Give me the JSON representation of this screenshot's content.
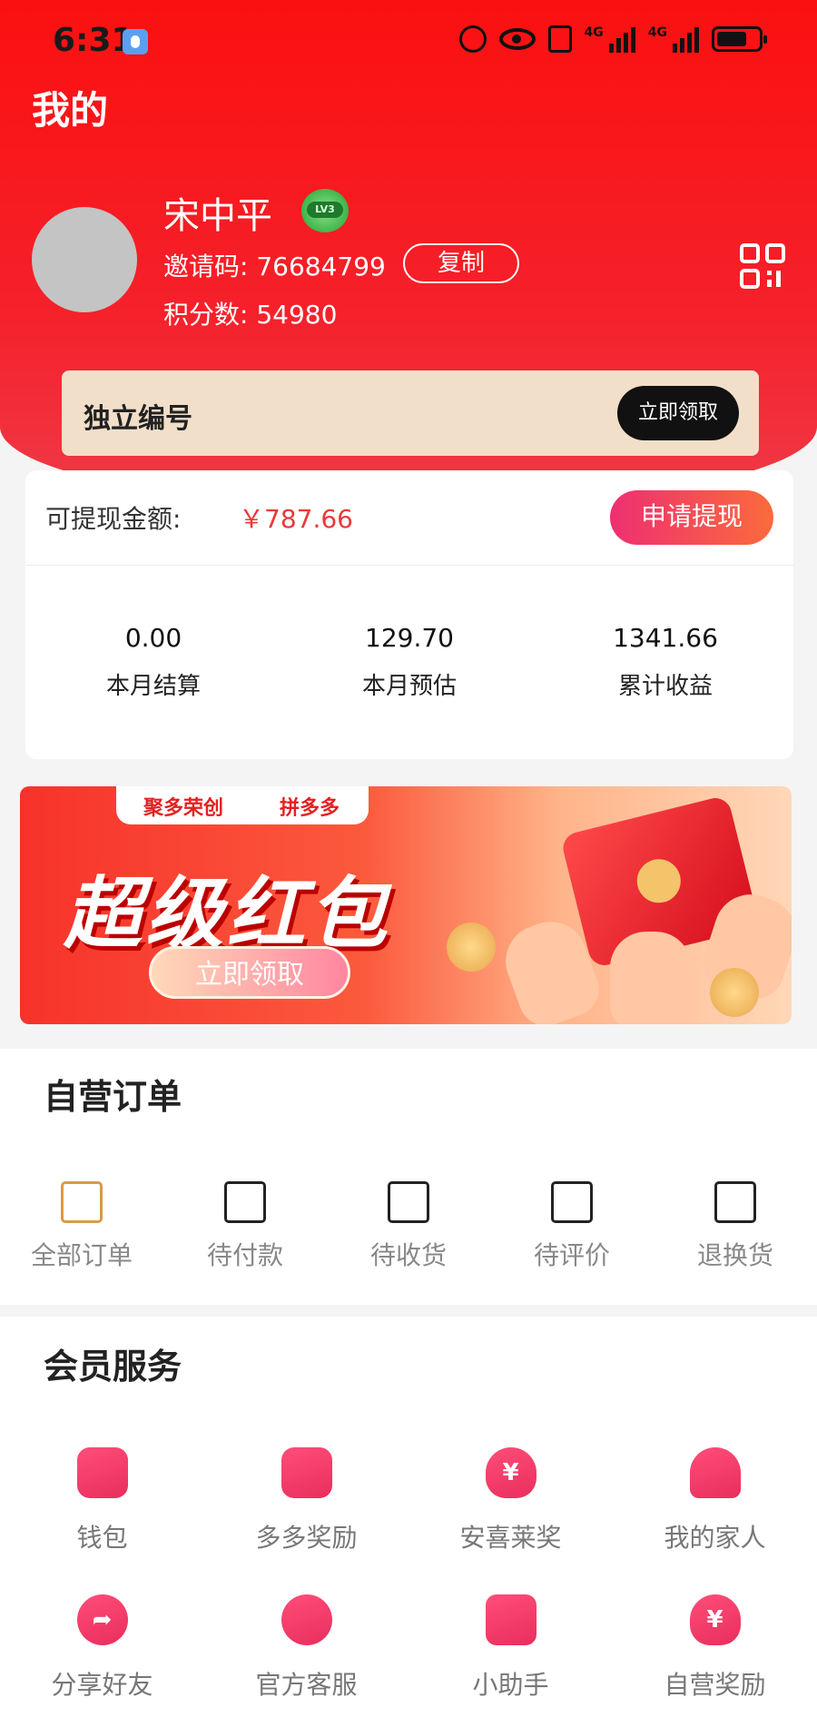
{
  "status_bar": {
    "time": "6:31",
    "network": "4G"
  },
  "header": {
    "title": "我的",
    "user_name": "宋中平",
    "level_badge": "LV3",
    "invite_label": "邀请码: 76684799",
    "copy_label": "复制",
    "points_label": "积分数: 54980"
  },
  "id_card": {
    "label": "独立编号",
    "button": "立即领取"
  },
  "earnings": {
    "withdraw_label": "可提现金额:",
    "withdraw_amount": "￥787.66",
    "withdraw_button": "申请提现",
    "stats": [
      {
        "value": "0.00",
        "label": "本月结算"
      },
      {
        "value": "129.70",
        "label": "本月预估"
      },
      {
        "value": "1341.66",
        "label": "累计收益"
      }
    ]
  },
  "banner": {
    "brand1": "聚多荣创",
    "brand2": "拼多多",
    "title": "超级红包",
    "button": "立即领取"
  },
  "orders": {
    "title": "自营订单",
    "items": [
      {
        "label": "全部订单",
        "icon": "clipboard-icon"
      },
      {
        "label": "待付款",
        "icon": "wallet-icon"
      },
      {
        "label": "待收货",
        "icon": "truck-icon"
      },
      {
        "label": "待评价",
        "icon": "review-icon"
      },
      {
        "label": "退换货",
        "icon": "box-icon"
      }
    ]
  },
  "services": {
    "title": "会员服务",
    "items": [
      {
        "label": "钱包",
        "icon": "wallet-icon"
      },
      {
        "label": "多多奖励",
        "icon": "document-icon"
      },
      {
        "label": "安喜莱奖",
        "icon": "money-bag-icon"
      },
      {
        "label": "我的家人",
        "icon": "family-icon"
      },
      {
        "label": "分享好友",
        "icon": "share-icon"
      },
      {
        "label": "官方客服",
        "icon": "headset-icon"
      },
      {
        "label": "小助手",
        "icon": "robot-icon"
      },
      {
        "label": "自营奖励",
        "icon": "money-bag-icon"
      }
    ]
  },
  "colors": {
    "brand_red": "#fb1010",
    "accent_pink": "#ee2f72",
    "amount_red": "#e83a3a"
  }
}
